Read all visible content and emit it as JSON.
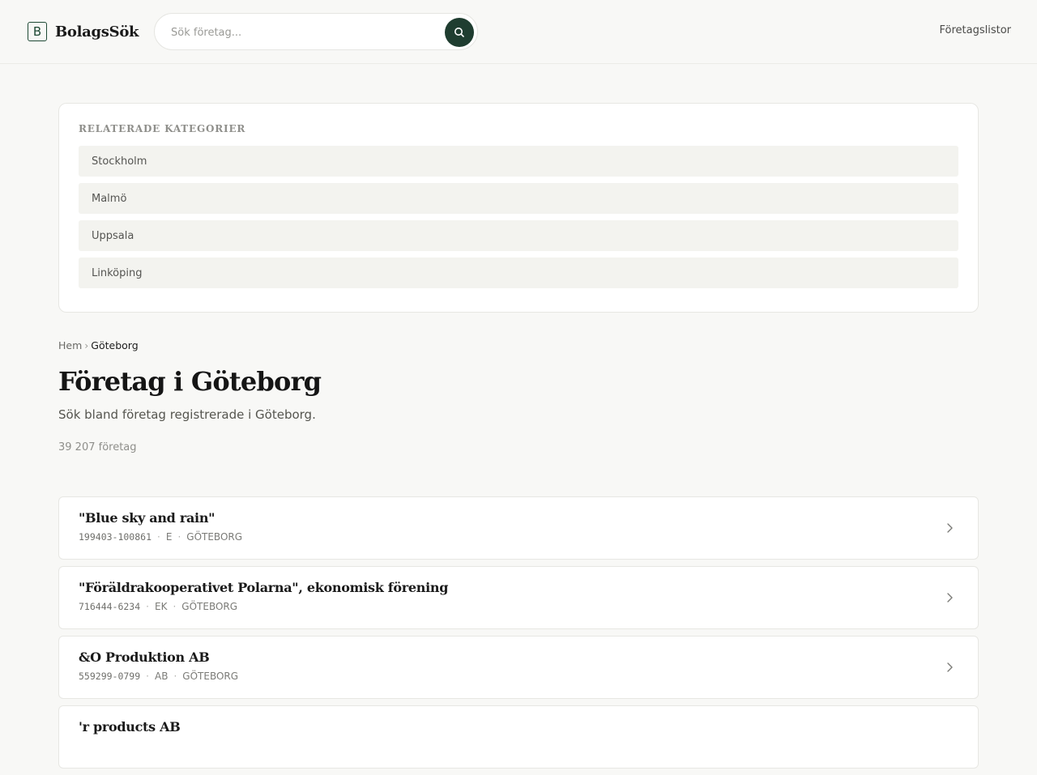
{
  "header": {
    "logo_letter": "B",
    "logo_text": "BolagsSök",
    "search_placeholder": "Sök företag...",
    "nav_link": "Företagslistor"
  },
  "categories": {
    "title": "RELATERADE KATEGORIER",
    "items": [
      {
        "label": "Stockholm"
      },
      {
        "label": "Malmö"
      },
      {
        "label": "Uppsala"
      },
      {
        "label": "Linköping"
      }
    ]
  },
  "breadcrumb": {
    "home": "Hem",
    "separator": "›",
    "current": "Göteborg"
  },
  "page": {
    "title": "Företag i Göteborg",
    "subtitle": "Sök bland företag registrerade i Göteborg.",
    "count": "39 207 företag"
  },
  "companies": [
    {
      "name": "\"Blue sky and rain\"",
      "org": "199403-100861",
      "type": "E",
      "city": "GÖTEBORG"
    },
    {
      "name": "\"Föräldrakooperativet Polarna\", ekonomisk förening",
      "org": "716444-6234",
      "type": "EK",
      "city": "GÖTEBORG"
    },
    {
      "name": "&O Produktion AB",
      "org": "559299-0799",
      "type": "AB",
      "city": "GÖTEBORG"
    },
    {
      "name": "'r products AB",
      "org": "",
      "type": "",
      "city": ""
    }
  ],
  "colors": {
    "accent": "#1f3d30",
    "background": "#f8f8f6",
    "card": "#ffffff"
  }
}
